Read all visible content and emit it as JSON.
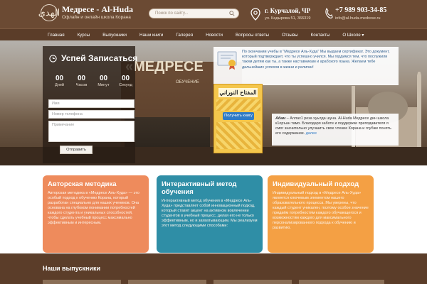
{
  "header": {
    "logo_text": "الهدى",
    "title": "Медресе - Al-Huda",
    "subtitle": "Офлайн и онлайн школа Корана",
    "search_placeholder": "Поиск по сайту...",
    "city": "г. Курчалой, ЧР",
    "street": "ул. Кадырова 51, 366319",
    "phone": "+7 989 903-34-85",
    "email": "info@al-huda-medrese.ru"
  },
  "nav": {
    "items": [
      "Главная",
      "Курсы",
      "Выпускники",
      "Наши книги",
      "Галерея",
      "Новости",
      "Вопросы ответы",
      "Отзывы",
      "Контакты",
      "О Школе"
    ]
  },
  "signup": {
    "title": "Успей Записаться",
    "counters": [
      {
        "num": "00",
        "label": "Дней"
      },
      {
        "num": "00",
        "label": "Часов"
      },
      {
        "num": "00",
        "label": "Минут"
      },
      {
        "num": "00",
        "label": "Секунд"
      }
    ],
    "name_placeholder": "Имя",
    "phone_placeholder": "Номер телефона",
    "note_placeholder": "Примечание",
    "submit_label": "Отправить"
  },
  "certificate": {
    "text": "По окончании учебы в \"Медресе Аль-Худа\" Мы выдаем сертификат. Это документ, который подтверждает, что ты успешно учился. Мы гордимся тем, что послужили таким детям как ты, а также наставникам и арабского языка. Желаем тебе дальнейших успехов в жизни и религии!"
  },
  "book": {
    "title": "المفتاح النوراني",
    "button_label": "Получить книгу"
  },
  "adam": {
    "name": "Адам",
    "text": " – Аллах1 реза хуьлда шуна. Al-Huda Медресе дин школа к1оръан тамо. Благодаря заботе и поддержке преподавателя я смог значительно улучшить свое чтение Корана и глубже понять его содержание.",
    "more": "далее"
  },
  "cards": [
    {
      "title": "Авторская методика",
      "text": "Авторская методика в «Медресе Аль-Худа» — это особый подход к обучению Корана, который разработан специально для наших учеников. Она основана на глубоком понимании потребностей каждого студента и уникальных способностей, чтобы сделать учебный процесс максимально эффективным и интересным."
    },
    {
      "title": "Интерактивный метод обучения",
      "text": "Интерактивный метод обучения в «Медресе Аль-Худа» представляет собой инновационный подход, который ставит акцент на активном вовлечении студентов в учебный процесс, делая его не только эффективным, но и захватывающим. Мы реализуем этот метод следующими способами:"
    },
    {
      "title": "Индивидуальный подход",
      "text": "Индивидуальный подход в «Медресе Аль-Худа» является ключевым элементом нашего образовательного процесса. Мы уверены, что каждый студент уникален, поэтому особое значение придаём потребностям каждого обучающегося и возможностям каждого для максимального персонализированного подхода к обучению и развитию."
    }
  ],
  "graduates": {
    "title": "Наши выпускники"
  },
  "colors": {
    "header_bg": "#6b4a33",
    "nav_bg": "#5b3d29",
    "card_orange": "#ee8b5c",
    "card_teal": "#2f8ea6",
    "card_orange2": "#f4a044",
    "link": "#2f7bc6"
  },
  "icons": [
    "map-pin-icon",
    "phone-icon",
    "search-icon",
    "clock-icon",
    "certificate-icon"
  ]
}
